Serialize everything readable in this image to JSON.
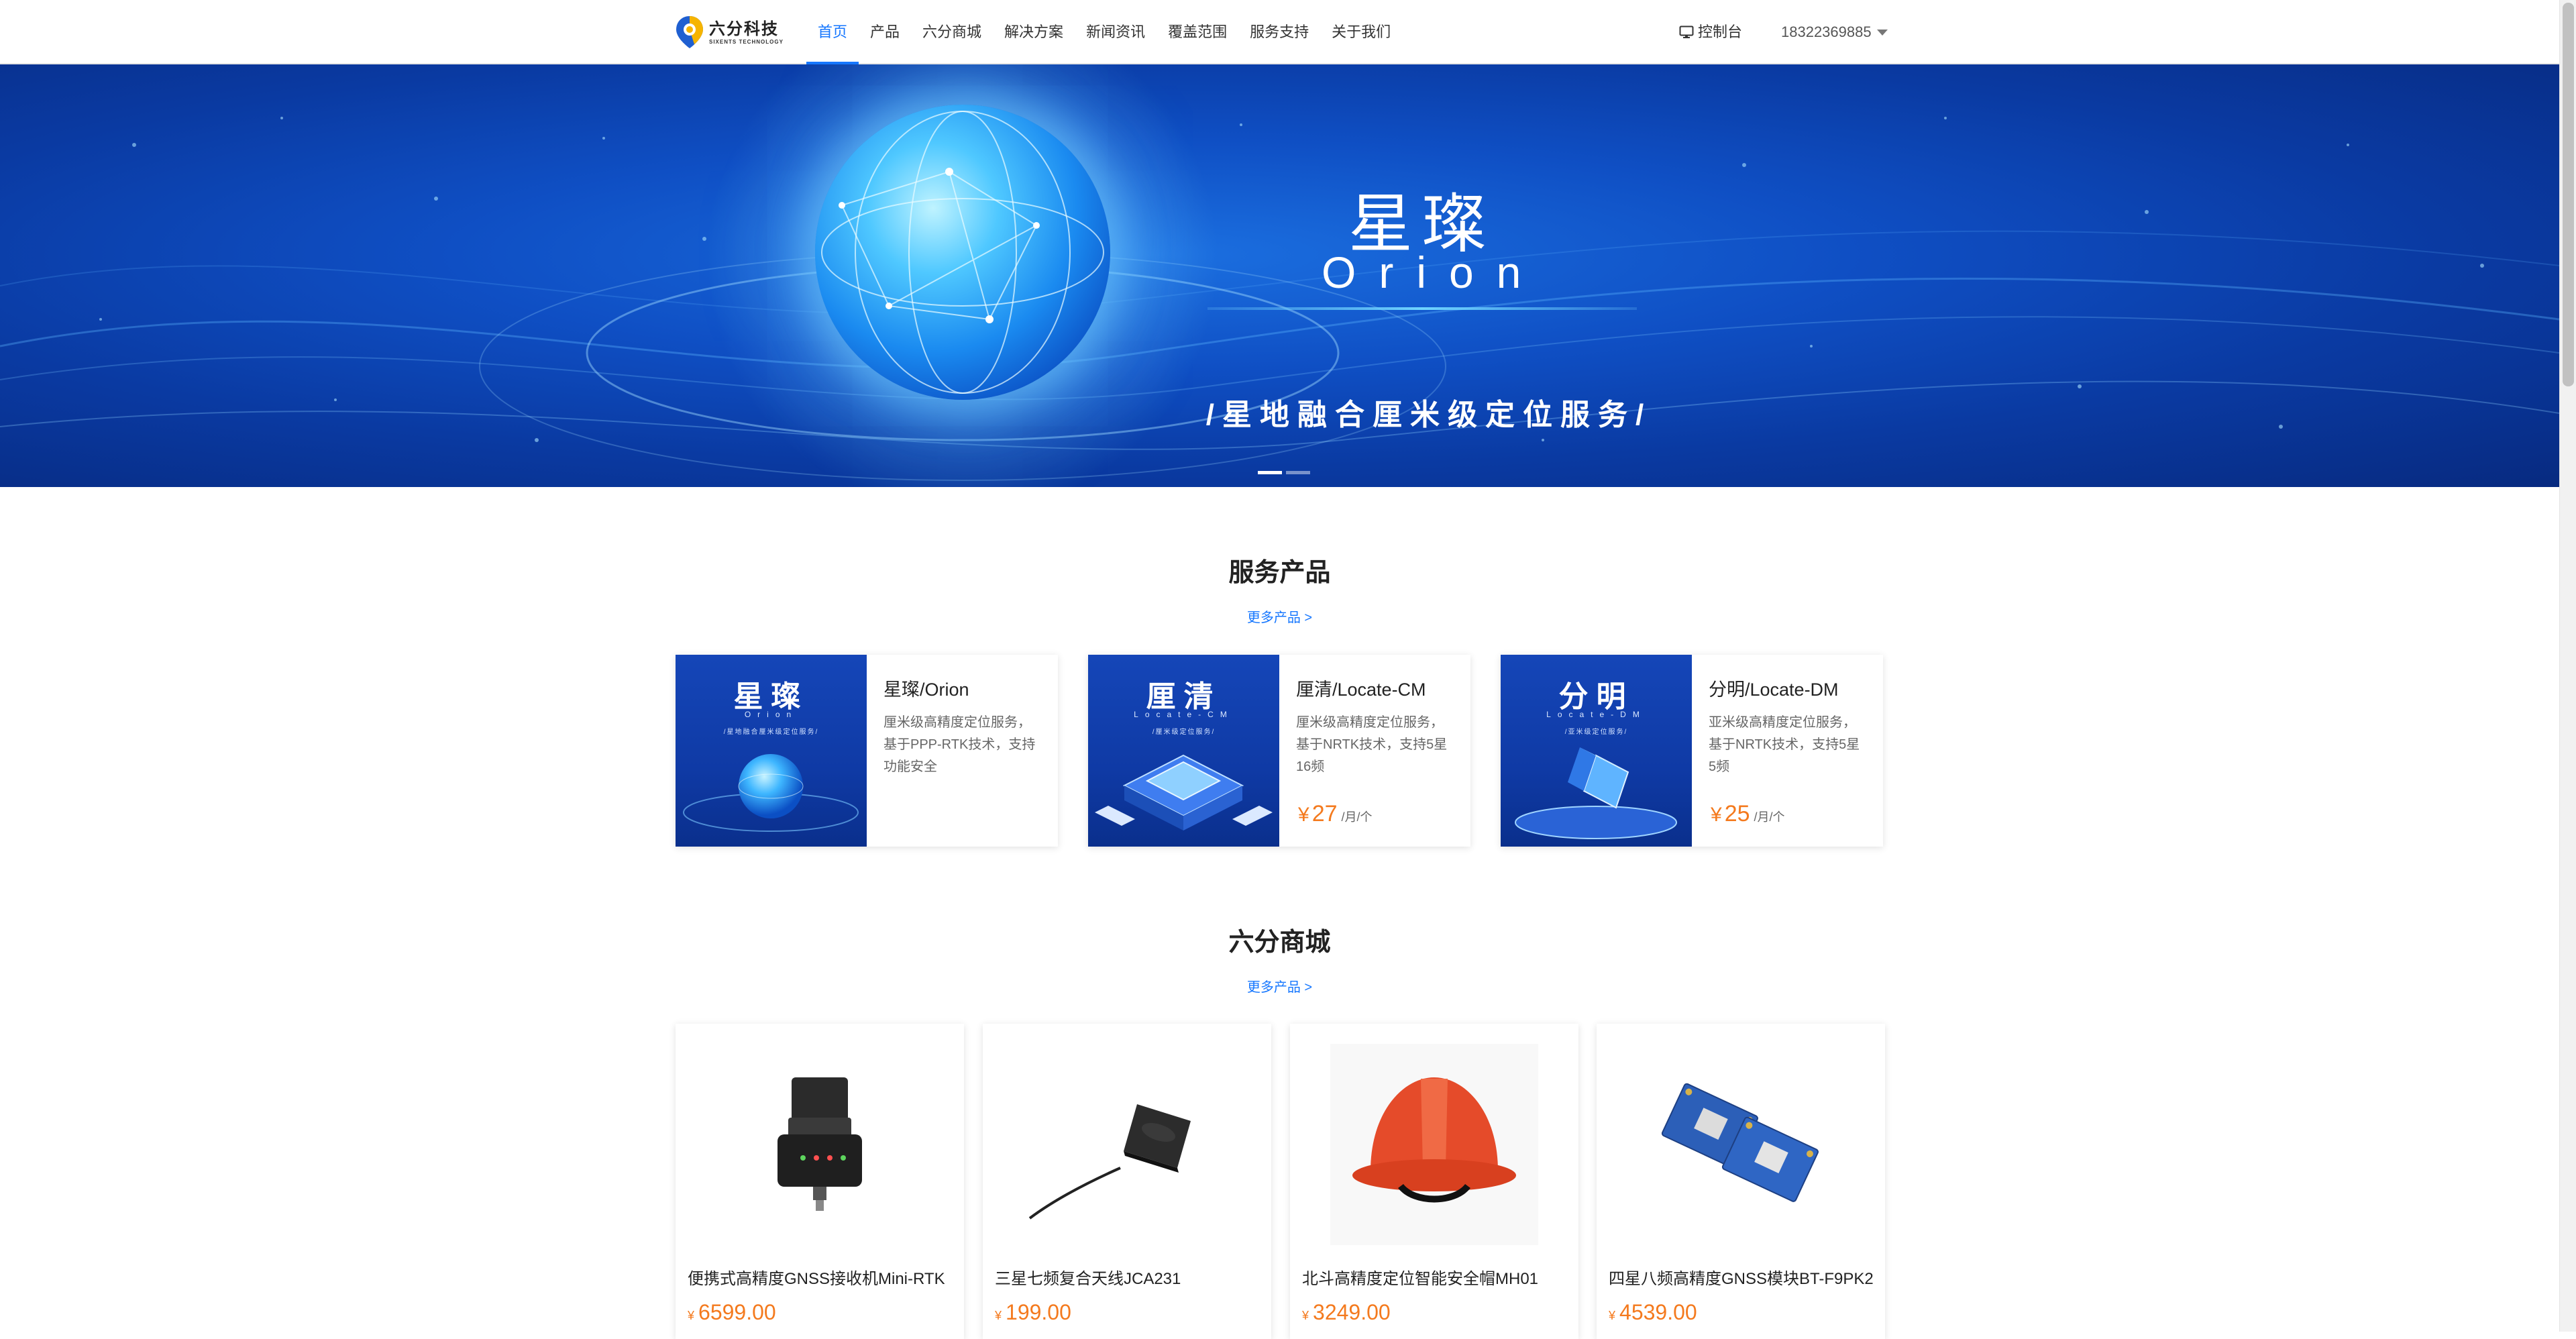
{
  "header": {
    "logo_cn": "六分科技",
    "logo_en": "SIXENTS TECHNOLOGY",
    "nav": [
      "首页",
      "产品",
      "六分商城",
      "解决方案",
      "新闻资讯",
      "覆盖范围",
      "服务支持",
      "关于我们"
    ],
    "active_nav": "首页",
    "console_label": "控制台",
    "account": "18322369885"
  },
  "banner": {
    "title": "星璨",
    "subtitle": "Orion",
    "slogan": "/星地融合厘米级定位服务/",
    "slides": 2,
    "active_slide": 1
  },
  "services": {
    "title": "服务产品",
    "more": "更多产品 >",
    "items": [
      {
        "img_title": "星璨",
        "img_sub": "Orion",
        "img_slogan": "/星地融合厘米级定位服务/",
        "name": "星璨/Orion",
        "desc": "厘米级高精度定位服务，基于PPP-RTK技术，支持功能安全",
        "price": "",
        "unit": ""
      },
      {
        "img_title": "厘清",
        "img_sub": "Locate-CM",
        "img_slogan": "/厘米级定位服务/",
        "name": "厘清/Locate-CM",
        "desc": "厘米级高精度定位服务，基于NRTK技术，支持5星16频",
        "price": "27",
        "unit": "/月/个"
      },
      {
        "img_title": "分明",
        "img_sub": "Locate-DM",
        "img_slogan": "/亚米级定位服务/",
        "name": "分明/Locate-DM",
        "desc": "亚米级高精度定位服务，基于NRTK技术，支持5星5频",
        "price": "25",
        "unit": "/月/个"
      }
    ]
  },
  "shop": {
    "title": "六分商城",
    "more": "更多产品 >",
    "currency": "¥",
    "items": [
      {
        "name": "便携式高精度GNSS接收机Mini-RTK",
        "price": "6599.00",
        "icon": "gnss-receiver-icon"
      },
      {
        "name": "三星七频复合天线JCA231",
        "price": "199.00",
        "icon": "antenna-icon"
      },
      {
        "name": "北斗高精度定位智能安全帽MH01",
        "price": "3249.00",
        "icon": "helmet-icon"
      },
      {
        "name": "四星八频高精度GNSS模块BT-F9PK2",
        "price": "4539.00",
        "icon": "gnss-module-icon"
      }
    ]
  },
  "colors": {
    "primary": "#1677ff",
    "price": "#f47a1e",
    "banner_dark": "#072a80",
    "banner_light": "#1b6fe0"
  }
}
